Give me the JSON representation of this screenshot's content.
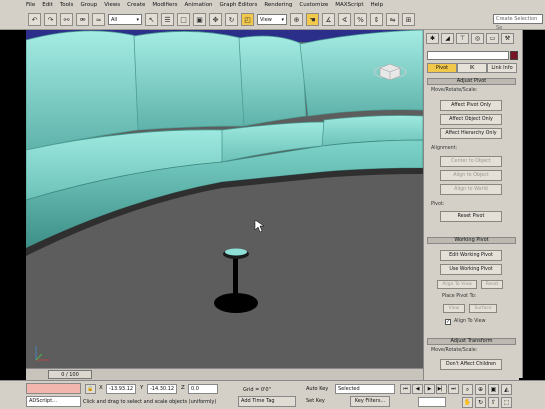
{
  "menu": [
    "File",
    "Edit",
    "Tools",
    "Group",
    "Views",
    "Create",
    "Modifiers",
    "Animation",
    "Graph Editors",
    "Rendering",
    "Customize",
    "MAXScript",
    "Help"
  ],
  "toolbar": {
    "selection_filter": "All",
    "reference_coord": "View",
    "search_placeholder": "Create Selection Se"
  },
  "panel": {
    "tab_icons": [
      "create-icon",
      "modify-icon",
      "hierarchy-icon",
      "motion-icon",
      "display-icon",
      "utilities-icon"
    ],
    "hierarchy_tabs": [
      "Pivot",
      "IK",
      "Link Info"
    ],
    "active_hierarchy_tab": "Pivot",
    "object_color": "#7a1424",
    "adjust_pivot": {
      "title": "Adjust Pivot",
      "move_rotate_scale": "Move/Rotate/Scale:",
      "affect_pivot_only": "Affect Pivot Only",
      "affect_object_only": "Affect Object Only",
      "affect_hierarchy_only": "Affect Hierarchy Only",
      "alignment": "Alignment:",
      "center_to_object": "Center to Object",
      "align_to_object": "Align to Object",
      "align_to_world": "Align to World",
      "pivot": "Pivot:",
      "reset_pivot": "Reset Pivot"
    },
    "working_pivot": {
      "title": "Working Pivot",
      "edit_working_pivot": "Edit Working Pivot",
      "use_working_pivot": "Use Working Pivot",
      "align_to_view": "Align To View",
      "reset": "Reset",
      "place_pivot_to": "Place Pivot To:",
      "view": "View",
      "surface": "Surface",
      "align_to_view_check": "Align To View"
    },
    "adjust_transform": {
      "title": "Adjust Transform",
      "move_rotate_scale": "Move/Rotate/Scale:",
      "dont_affect_children": "Don't Affect Children"
    }
  },
  "time_slider": {
    "label": "0 / 100",
    "current": 0,
    "total": 100
  },
  "status": {
    "maxscript_line": "ADScrlipt...",
    "x_label": "X",
    "x_value": "-13.93.12",
    "y_label": "Y",
    "y_value": "-14.30.12",
    "z_label": "Z",
    "z_value": "0.0",
    "grid": "Grid = 0'0\"",
    "prompt": "Click and drag to select and scale objects (uniformly)",
    "add_time_tag": "Add Time Tag",
    "auto_key": "Auto Key",
    "selected": "Selected",
    "set_key": "Set Key",
    "key_filters": "Key Filters...",
    "frame": ""
  },
  "colors": {
    "sofa": "#8ee0d6",
    "floor": "#5d5d5d",
    "ui_grey": "#d4d0c8",
    "active": "#f2c84a"
  }
}
